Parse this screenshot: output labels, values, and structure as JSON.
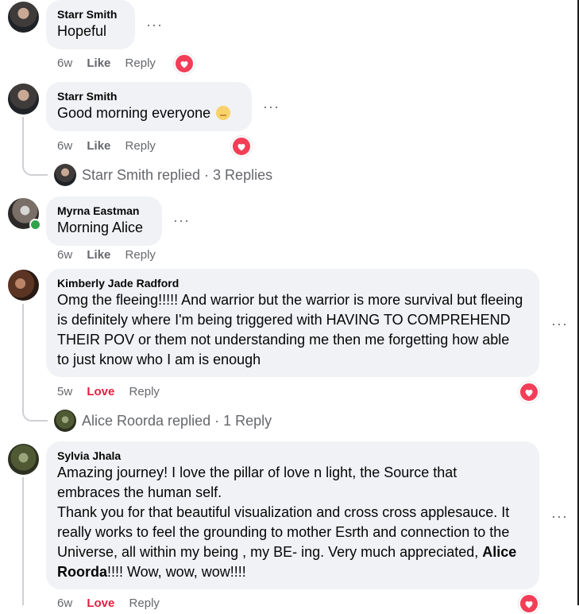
{
  "comments": [
    {
      "author": "Starr Smith",
      "text": "Hopeful",
      "time": "6w",
      "reaction_label": "Like",
      "reply_label": "Reply",
      "reaction": "heart"
    },
    {
      "author": "Starr Smith",
      "text": "Good morning everyone",
      "time": "6w",
      "reaction_label": "Like",
      "reply_label": "Reply",
      "reaction": "heart",
      "replies_summary": "Starr Smith replied · 3 Replies"
    },
    {
      "author": "Myrna Eastman",
      "text": "Morning Alice",
      "time": "6w",
      "reaction_label": "Like",
      "reply_label": "Reply"
    },
    {
      "author": "Kimberly Jade Radford",
      "text": "Omg the fleeing!!!!! And warrior but the warrior is more survival but fleeing is definitely where I'm being triggered with HAVING TO COMPREHEND THEIR POV or them not understanding me then me forgetting how able to just know who I am is enough",
      "time": "5w",
      "reaction_label": "Love",
      "reply_label": "Reply",
      "reaction": "heart",
      "replies_summary": "Alice Roorda replied · 1 Reply"
    },
    {
      "author": "Sylvia Jhala",
      "text_line1": "Amazing journey! I love the pillar of love n light, the Source that embraces the human self.",
      "text_line2": "Thank you for that beautiful visualization and cross cross applesauce. It really works to feel the grounding to mother Esrth and connection to the Universe, all within my being , my BE- ing. Very much appreciated,",
      "mention": "Alice Roorda",
      "text_end": "!!!! Wow, wow, wow!!!!",
      "time": "6w",
      "reaction_label": "Love",
      "reply_label": "Reply",
      "reaction": "heart"
    }
  ],
  "more_icon": "more-options-icon",
  "colors": {
    "bubble": "#f0f2f5",
    "love": "#e41e3f",
    "heart_reaction": "#f33e58",
    "online": "#31a24c"
  }
}
